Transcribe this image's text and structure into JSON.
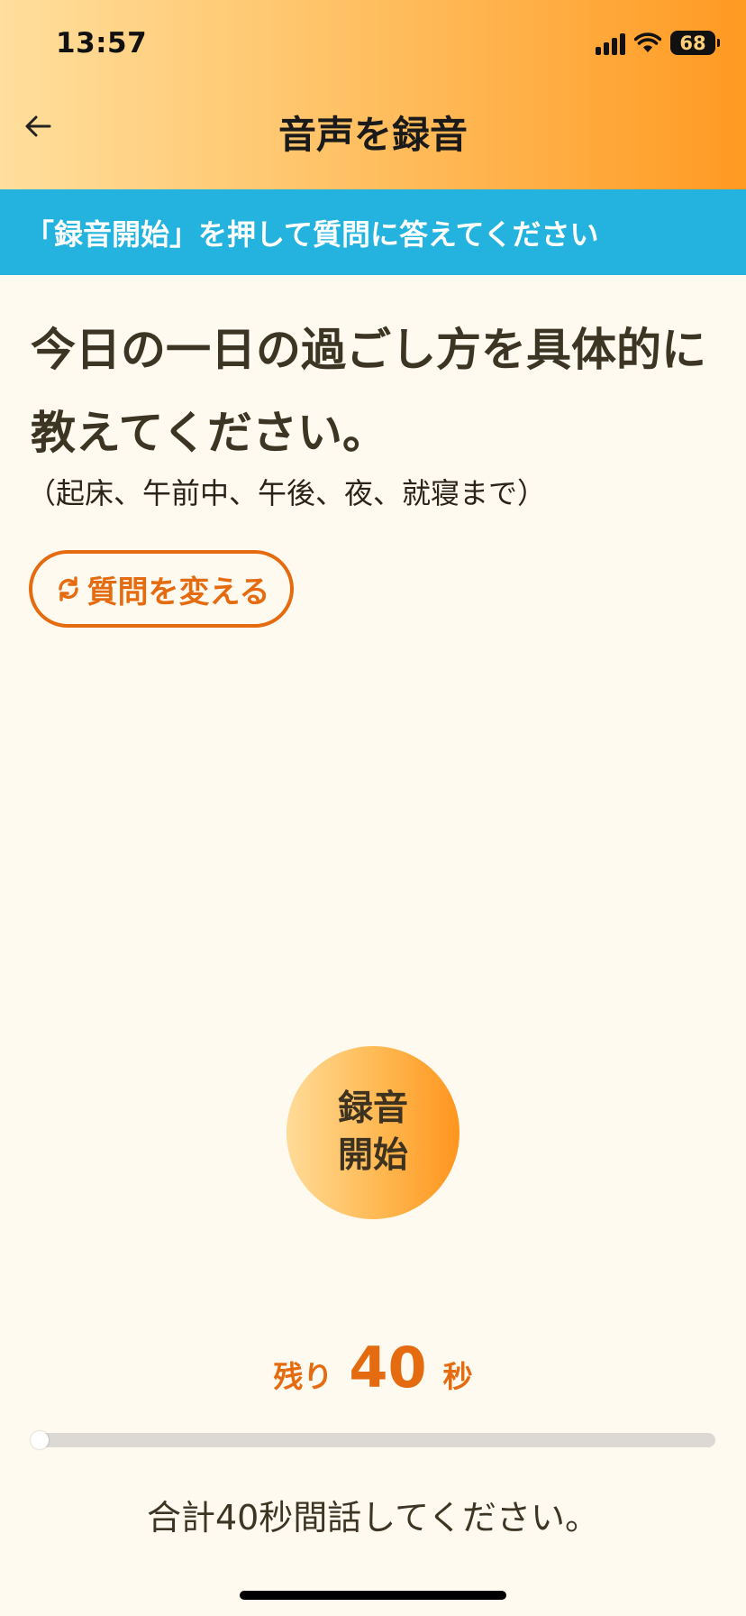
{
  "status_bar": {
    "time": "13:57",
    "battery": "68"
  },
  "nav": {
    "title": "音声を録音"
  },
  "banner": {
    "text": "「録音開始」を押して質問に答えてください"
  },
  "question": {
    "main": "今日の一日の過ごし方を具体的に教えてください。",
    "sub": "（起床、午前中、午後、夜、就寝まで）"
  },
  "change_button": {
    "label": "質問を変える"
  },
  "record_button": {
    "label": "録音開始"
  },
  "timer": {
    "prefix": "残り",
    "seconds": "40",
    "suffix": "秒",
    "progress": 0
  },
  "footer": {
    "text": "合計40秒間話してください。"
  },
  "colors": {
    "accent": "#e56b10",
    "banner": "#23b3de",
    "background": "#fffaef",
    "text": "#3d3524"
  },
  "icons": {
    "back": "arrow-left-icon",
    "change": "refresh-icon",
    "wifi": "wifi-icon",
    "signal": "cellular-signal-icon",
    "battery": "battery-icon"
  }
}
